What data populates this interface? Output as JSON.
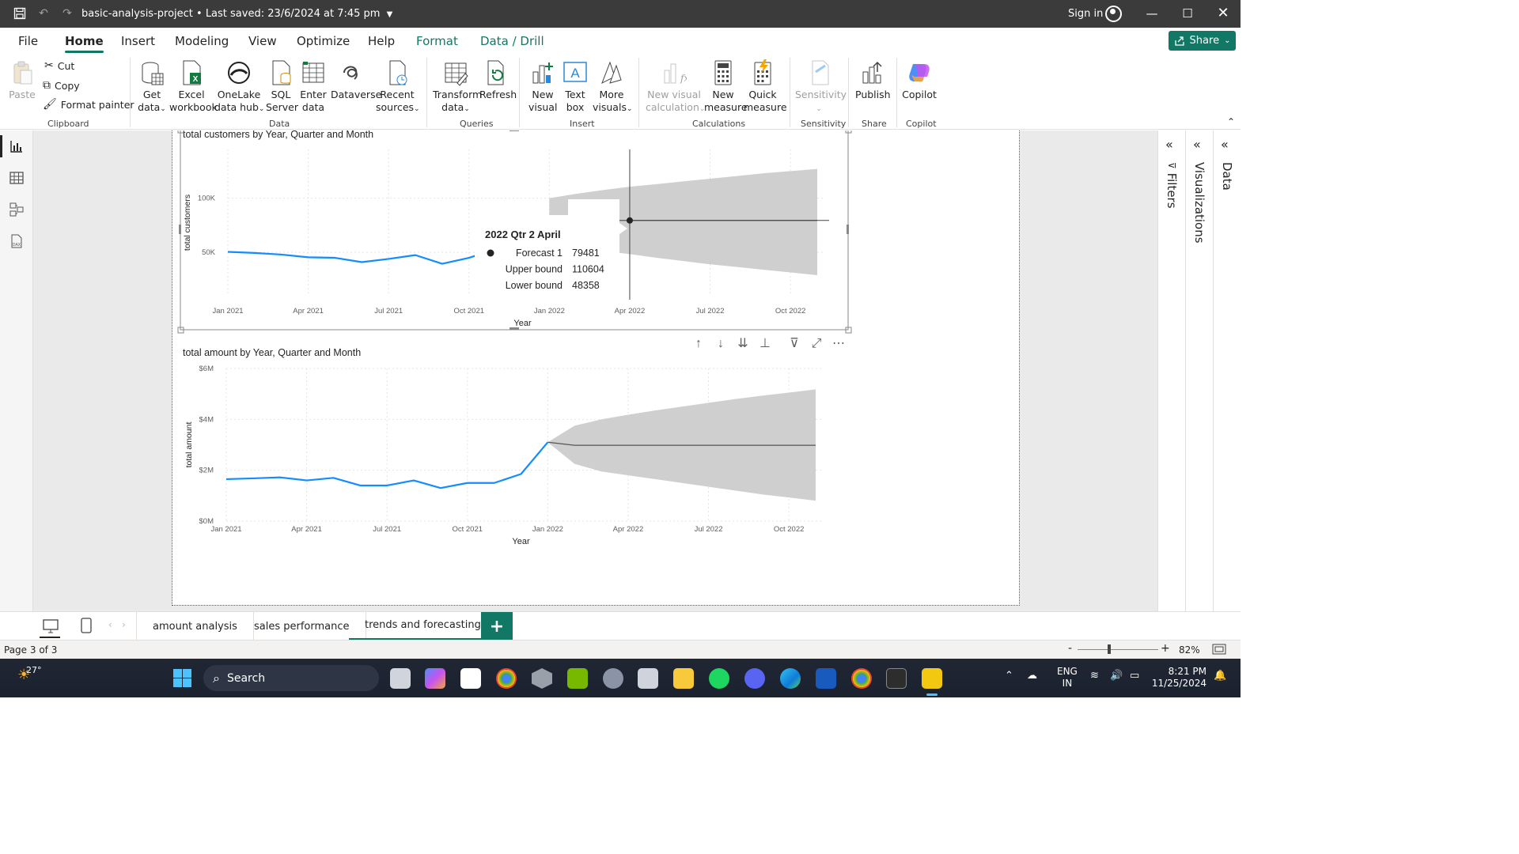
{
  "titlebar": {
    "title": "basic-analysis-project • Last saved: 23/6/2024 at 7:45 pm",
    "sign_in": "Sign in"
  },
  "ribbon_tabs": [
    "File",
    "Home",
    "Insert",
    "Modeling",
    "View",
    "Optimize",
    "Help",
    "Format",
    "Data / Drill"
  ],
  "active_tab": "Home",
  "share_label": "Share",
  "clipboard": {
    "paste": "Paste",
    "cut": "Cut",
    "copy": "Copy",
    "format_painter": "Format painter",
    "label": "Clipboard"
  },
  "data_group": {
    "get_data": [
      "Get",
      "data"
    ],
    "excel": [
      "Excel",
      "workbook"
    ],
    "onelake": [
      "OneLake",
      "data hub"
    ],
    "sql": [
      "SQL",
      "Server"
    ],
    "enter": [
      "Enter",
      "data"
    ],
    "dataverse": [
      "Dataverse"
    ],
    "recent": [
      "Recent",
      "sources"
    ],
    "label": "Data"
  },
  "queries_group": {
    "transform": [
      "Transform",
      "data"
    ],
    "refresh": [
      "Refresh"
    ],
    "label": "Queries"
  },
  "insert_group": {
    "new_visual": [
      "New",
      "visual"
    ],
    "text_box": [
      "Text",
      "box"
    ],
    "more_visuals": [
      "More",
      "visuals"
    ],
    "label": "Insert"
  },
  "calc_group": {
    "new_visual_calc": [
      "New visual",
      "calculation"
    ],
    "new_measure": [
      "New",
      "measure"
    ],
    "quick_measure": [
      "Quick",
      "measure"
    ],
    "label": "Calculations"
  },
  "sensitivity_group": {
    "sensitivity": [
      "Sensitivity"
    ],
    "label": "Sensitivity"
  },
  "share_group": {
    "publish": [
      "Publish"
    ],
    "label": "Share"
  },
  "copilot_group": {
    "copilot": [
      "Copilot"
    ],
    "label": "Copilot"
  },
  "right_panes": {
    "filters": "Filters",
    "visualizations": "Visualizations",
    "data": "Data"
  },
  "page_tabs": [
    "amount analysis",
    "sales performance",
    "trends and forecasting"
  ],
  "active_page": "trends and forecasting",
  "status": {
    "page": "Page 3 of 3",
    "zoom": "82%"
  },
  "taskbar": {
    "temperature": "27°",
    "search": "Search",
    "lang1": "ENG",
    "lang2": "IN",
    "time": "8:21 PM",
    "date": "11/25/2024"
  },
  "chart_data": [
    {
      "type": "line",
      "title": "total customers by Year, Quarter and Month",
      "xlabel": "Year",
      "ylabel": "total customers",
      "x_ticks": [
        "Jan 2021",
        "Apr 2021",
        "Jul 2021",
        "Oct 2021",
        "Jan 2022",
        "Apr 2022",
        "Jul 2022",
        "Oct 2022"
      ],
      "y_ticks": [
        "50K",
        "100K"
      ],
      "ylim": [
        10000,
        145000
      ],
      "grid": true,
      "series": [
        {
          "x": [
            "Jan 2021",
            "Feb 2021",
            "Mar 2021",
            "Apr 2021",
            "May 2021",
            "Jun 2021",
            "Jul 2021",
            "Aug 2021",
            "Sep 2021",
            "Oct 2021",
            "Nov 2021"
          ],
          "values": [
            50500,
            49500,
            48000,
            45500,
            45000,
            41000,
            44000,
            47500,
            39500,
            45000,
            53000
          ]
        }
      ],
      "forecast": {
        "x": [
          "Jan 2022",
          "Feb 2022",
          "Mar 2022",
          "Apr 2022",
          "May 2022",
          "Jun 2022",
          "Jul 2022",
          "Aug 2022",
          "Sep 2022",
          "Oct 2022",
          "Nov 2022"
        ],
        "values": [
          79481,
          79481,
          79481,
          79481,
          79481,
          79481,
          79481,
          79481,
          79481,
          79481,
          79481
        ],
        "upper": [
          100000,
          104000,
          107500,
          110604,
          113000,
          115500,
          118000,
          120500,
          123000,
          125000,
          127000
        ],
        "lower": [
          64000,
          56000,
          51500,
          48358,
          45000,
          42000,
          39000,
          36500,
          34000,
          31500,
          29000
        ]
      },
      "tooltip": {
        "title": "2022 Qtr 2 April",
        "rows": [
          {
            "label": "Forecast 1",
            "value": "79481"
          },
          {
            "label": "Upper bound",
            "value": "110604"
          },
          {
            "label": "Lower bound",
            "value": "48358"
          }
        ]
      }
    },
    {
      "type": "line",
      "title": "total amount by Year, Quarter and Month",
      "xlabel": "Year",
      "ylabel": "total amount",
      "x_ticks": [
        "Jan 2021",
        "Apr 2021",
        "Jul 2021",
        "Oct 2021",
        "Jan 2022",
        "Apr 2022",
        "Jul 2022",
        "Oct 2022"
      ],
      "y_ticks": [
        "$0M",
        "$2M",
        "$4M",
        "$6M"
      ],
      "ylim": [
        0,
        6000000
      ],
      "grid": true,
      "series": [
        {
          "x": [
            "Jan 2021",
            "Feb 2021",
            "Mar 2021",
            "Apr 2021",
            "May 2021",
            "Jun 2021",
            "Jul 2021",
            "Aug 2021",
            "Sep 2021",
            "Oct 2021",
            "Nov 2021",
            "Dec 2021",
            "Jan 2022"
          ],
          "values": [
            1650000,
            1680000,
            1720000,
            1600000,
            1700000,
            1400000,
            1400000,
            1600000,
            1300000,
            1500000,
            1500000,
            1850000,
            3100000
          ]
        }
      ],
      "forecast": {
        "x": [
          "Jan 2022",
          "Feb 2022",
          "Mar 2022",
          "Apr 2022",
          "May 2022",
          "Jun 2022",
          "Jul 2022",
          "Aug 2022",
          "Sep 2022",
          "Oct 2022",
          "Nov 2022"
        ],
        "values": [
          3100000,
          2980000,
          2980000,
          2980000,
          2980000,
          2980000,
          2980000,
          2980000,
          2980000,
          2980000,
          2980000
        ],
        "upper": [
          3100000,
          3750000,
          4000000,
          4180000,
          4350000,
          4500000,
          4650000,
          4800000,
          4930000,
          5050000,
          5180000
        ],
        "lower": [
          3100000,
          2250000,
          1950000,
          1800000,
          1650000,
          1500000,
          1350000,
          1200000,
          1050000,
          930000,
          800000
        ]
      }
    }
  ]
}
